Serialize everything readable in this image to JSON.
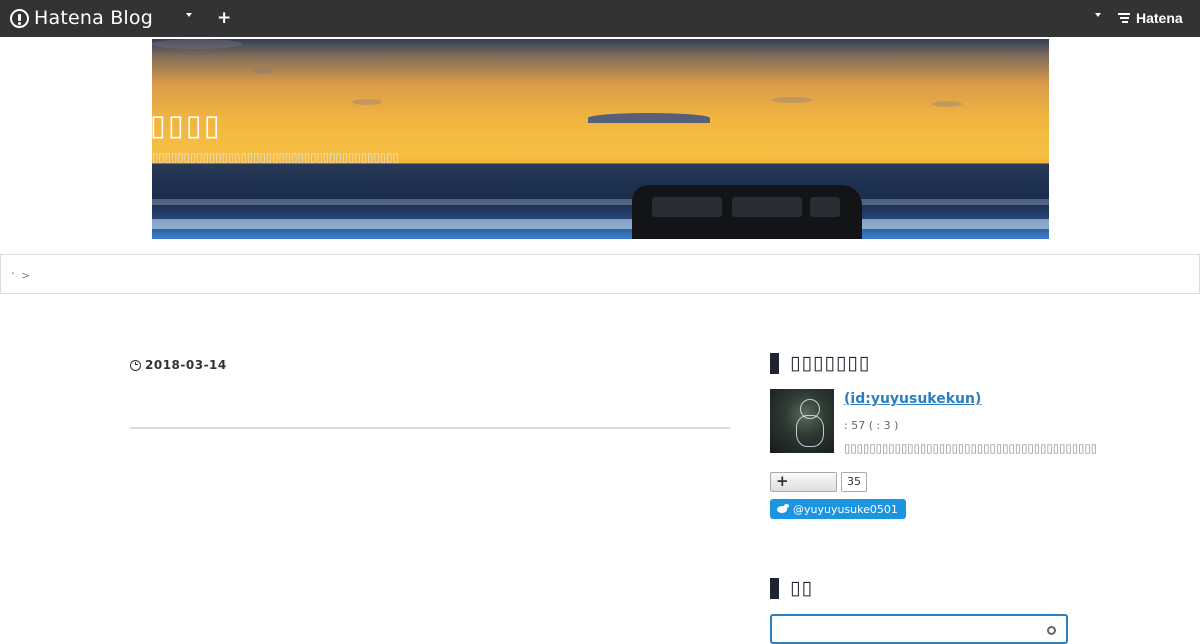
{
  "topbar": {
    "brand": "Hatena Blog",
    "add_label": "+",
    "right_brand": "Hatena"
  },
  "header": {
    "title": "▯▯▯▯",
    "description": "▯▯▯▯▯▯▯▯▯▯▯▯▯▯▯▯▯▯▯▯▯▯▯▯▯▯▯▯▯▯▯▯▯▯▯▯▯▯▯"
  },
  "breadcrumb": {
    "link": ".",
    "separator": ">"
  },
  "entry": {
    "date": "2018-03-14"
  },
  "sidebar": {
    "profile_title": "▯▯▯▯▯▯▯",
    "profile_name": " (id:yuyusukekun)",
    "profile_stats": ": 57 (      : 3   )",
    "profile_desc": "▯▯▯▯▯▯▯▯▯▯▯▯▯▯▯▯▯▯▯▯▯▯▯▯▯▯▯▯▯▯▯▯▯▯▯▯▯▯▯▯",
    "follow_label": "+",
    "follow_count": "35",
    "twitter_handle": "@yuyuyusuke0501",
    "search_title": "▯▯",
    "search_placeholder": ""
  },
  "colors": {
    "topbar": "#333333",
    "link": "#2a7fbf",
    "twitter": "#1b95e0",
    "module_heading": "#1f2433"
  }
}
